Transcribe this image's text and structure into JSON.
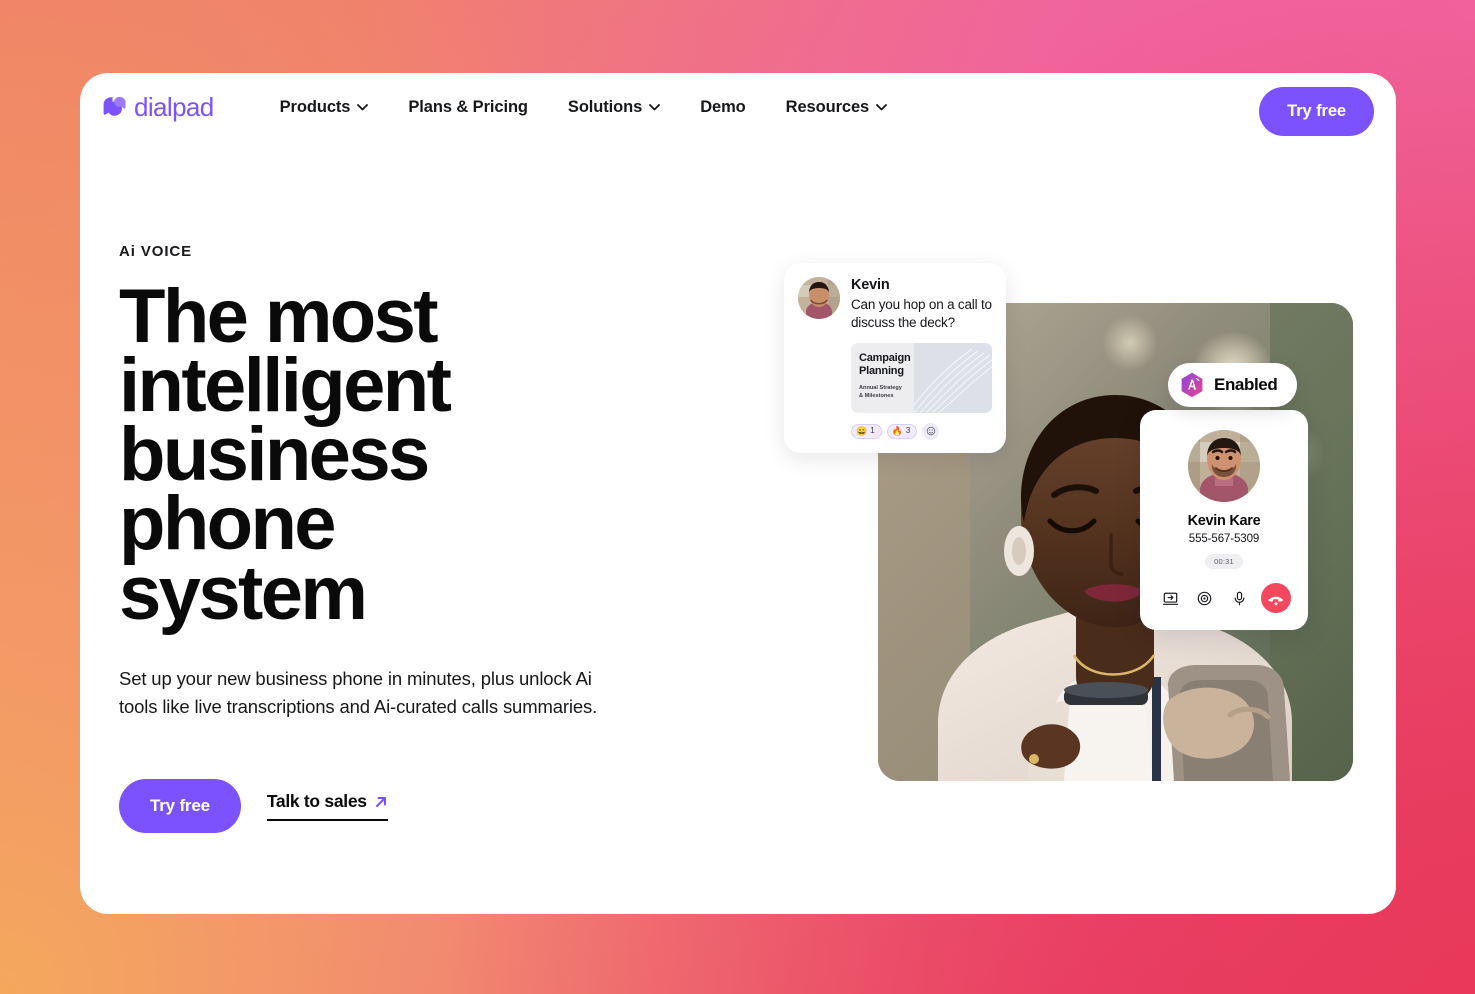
{
  "brand": {
    "name": "dialpad",
    "logo_icon": "dialpad-speech-bubbles-icon",
    "accent_purple": "#7C52FF"
  },
  "nav": {
    "items": [
      {
        "label": "Products",
        "has_dropdown": true,
        "chevron_icon": "chevron-down-icon"
      },
      {
        "label": "Plans & Pricing",
        "has_dropdown": false
      },
      {
        "label": "Solutions",
        "has_dropdown": true,
        "chevron_icon": "chevron-down-icon"
      },
      {
        "label": "Demo",
        "has_dropdown": false
      },
      {
        "label": "Resources",
        "has_dropdown": true,
        "chevron_icon": "chevron-down-icon"
      }
    ],
    "cta_label": "Try free"
  },
  "hero": {
    "eyebrow": "Ai VOICE",
    "headline": "The most intelligent business phone system",
    "subcopy": "Set up your new business phone in minutes, plus unlock Ai tools like live transcriptions and Ai-curated calls summaries.",
    "primary_cta": "Try free",
    "secondary_cta": "Talk to sales",
    "secondary_cta_icon": "arrow-up-right-icon"
  },
  "visual": {
    "photo_alt": "woman holding coffee cup looking at smartphone outdoors",
    "chat_card": {
      "avatar_icon": "user-avatar",
      "sender": "Kevin",
      "message": "Can you hop on a call to discuss the deck?",
      "attachment": {
        "title": "Campaign Planning",
        "subtitle": "Annual Strategy & Milestones",
        "thumbnail_icon": "wave-pattern-thumbnail"
      },
      "reactions": [
        {
          "emoji": "😄",
          "count": "1",
          "name": "smile-reaction"
        },
        {
          "emoji": "🔥",
          "count": "3",
          "name": "fire-reaction"
        }
      ],
      "add_reaction_icon": "add-reaction-icon"
    },
    "ai_badge": {
      "label": "Enabled",
      "icon": "ai-hexagon-icon",
      "gradient_from": "#8B46E0",
      "gradient_to": "#E8438F"
    },
    "call_card": {
      "avatar_icon": "user-avatar",
      "name": "Kevin Kare",
      "number": "555-567-5309",
      "timer": "00:31",
      "actions": [
        {
          "name": "screen-share-icon",
          "label": "Screen share"
        },
        {
          "name": "record-icon",
          "label": "Record"
        },
        {
          "name": "microphone-icon",
          "label": "Mute"
        },
        {
          "name": "end-call-icon",
          "label": "End call",
          "color": "#F4485E"
        }
      ]
    }
  }
}
